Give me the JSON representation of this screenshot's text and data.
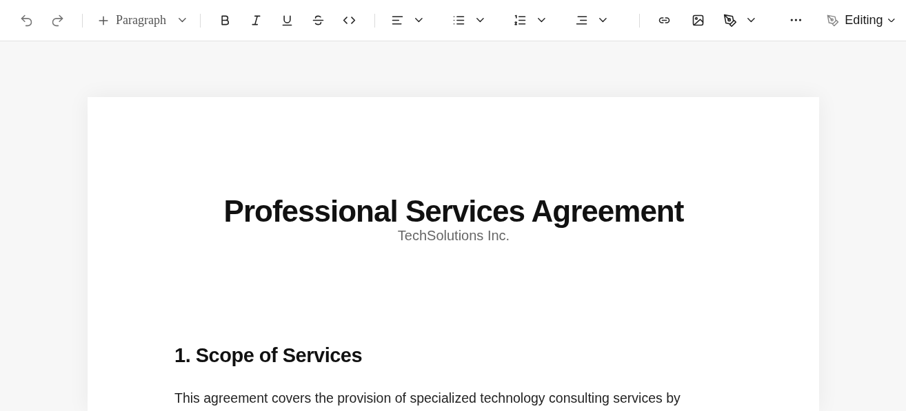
{
  "toolbar": {
    "groups": [
      [
        {
          "kind": "undo",
          "disabled": true,
          "dropdown": false
        },
        {
          "kind": "redo",
          "disabled": true,
          "dropdown": false
        }
      ],
      [
        {
          "kind": "block-type",
          "label": "Paragraph",
          "disabled": false,
          "dropdown": true
        }
      ],
      [
        {
          "kind": "bold",
          "disabled": false,
          "dropdown": false
        },
        {
          "kind": "italic",
          "disabled": false,
          "dropdown": false
        },
        {
          "kind": "underline",
          "disabled": false,
          "dropdown": false
        },
        {
          "kind": "strike",
          "disabled": false,
          "dropdown": false
        },
        {
          "kind": "code",
          "disabled": false,
          "dropdown": false
        }
      ],
      [
        {
          "kind": "align",
          "disabled": false,
          "dropdown": true
        },
        {
          "kind": "bullets",
          "disabled": false,
          "dropdown": true
        },
        {
          "kind": "numbers",
          "disabled": false,
          "dropdown": true
        },
        {
          "kind": "indent",
          "disabled": false,
          "dropdown": true
        }
      ],
      [
        {
          "kind": "link",
          "disabled": false,
          "dropdown": false
        },
        {
          "kind": "image",
          "disabled": false,
          "dropdown": false
        },
        {
          "kind": "pen",
          "disabled": false,
          "dropdown": true
        },
        {
          "kind": "more",
          "disabled": false,
          "dropdown": false
        }
      ]
    ],
    "mode": {
      "label": "Editing"
    }
  },
  "document": {
    "title": "Professional Services Agreement",
    "subtitle": "TechSolutions Inc.",
    "sections": [
      {
        "heading": "1. Scope of Services",
        "paragraphs": [
          "This agreement covers the provision of specialized technology consulting services by"
        ]
      }
    ]
  }
}
